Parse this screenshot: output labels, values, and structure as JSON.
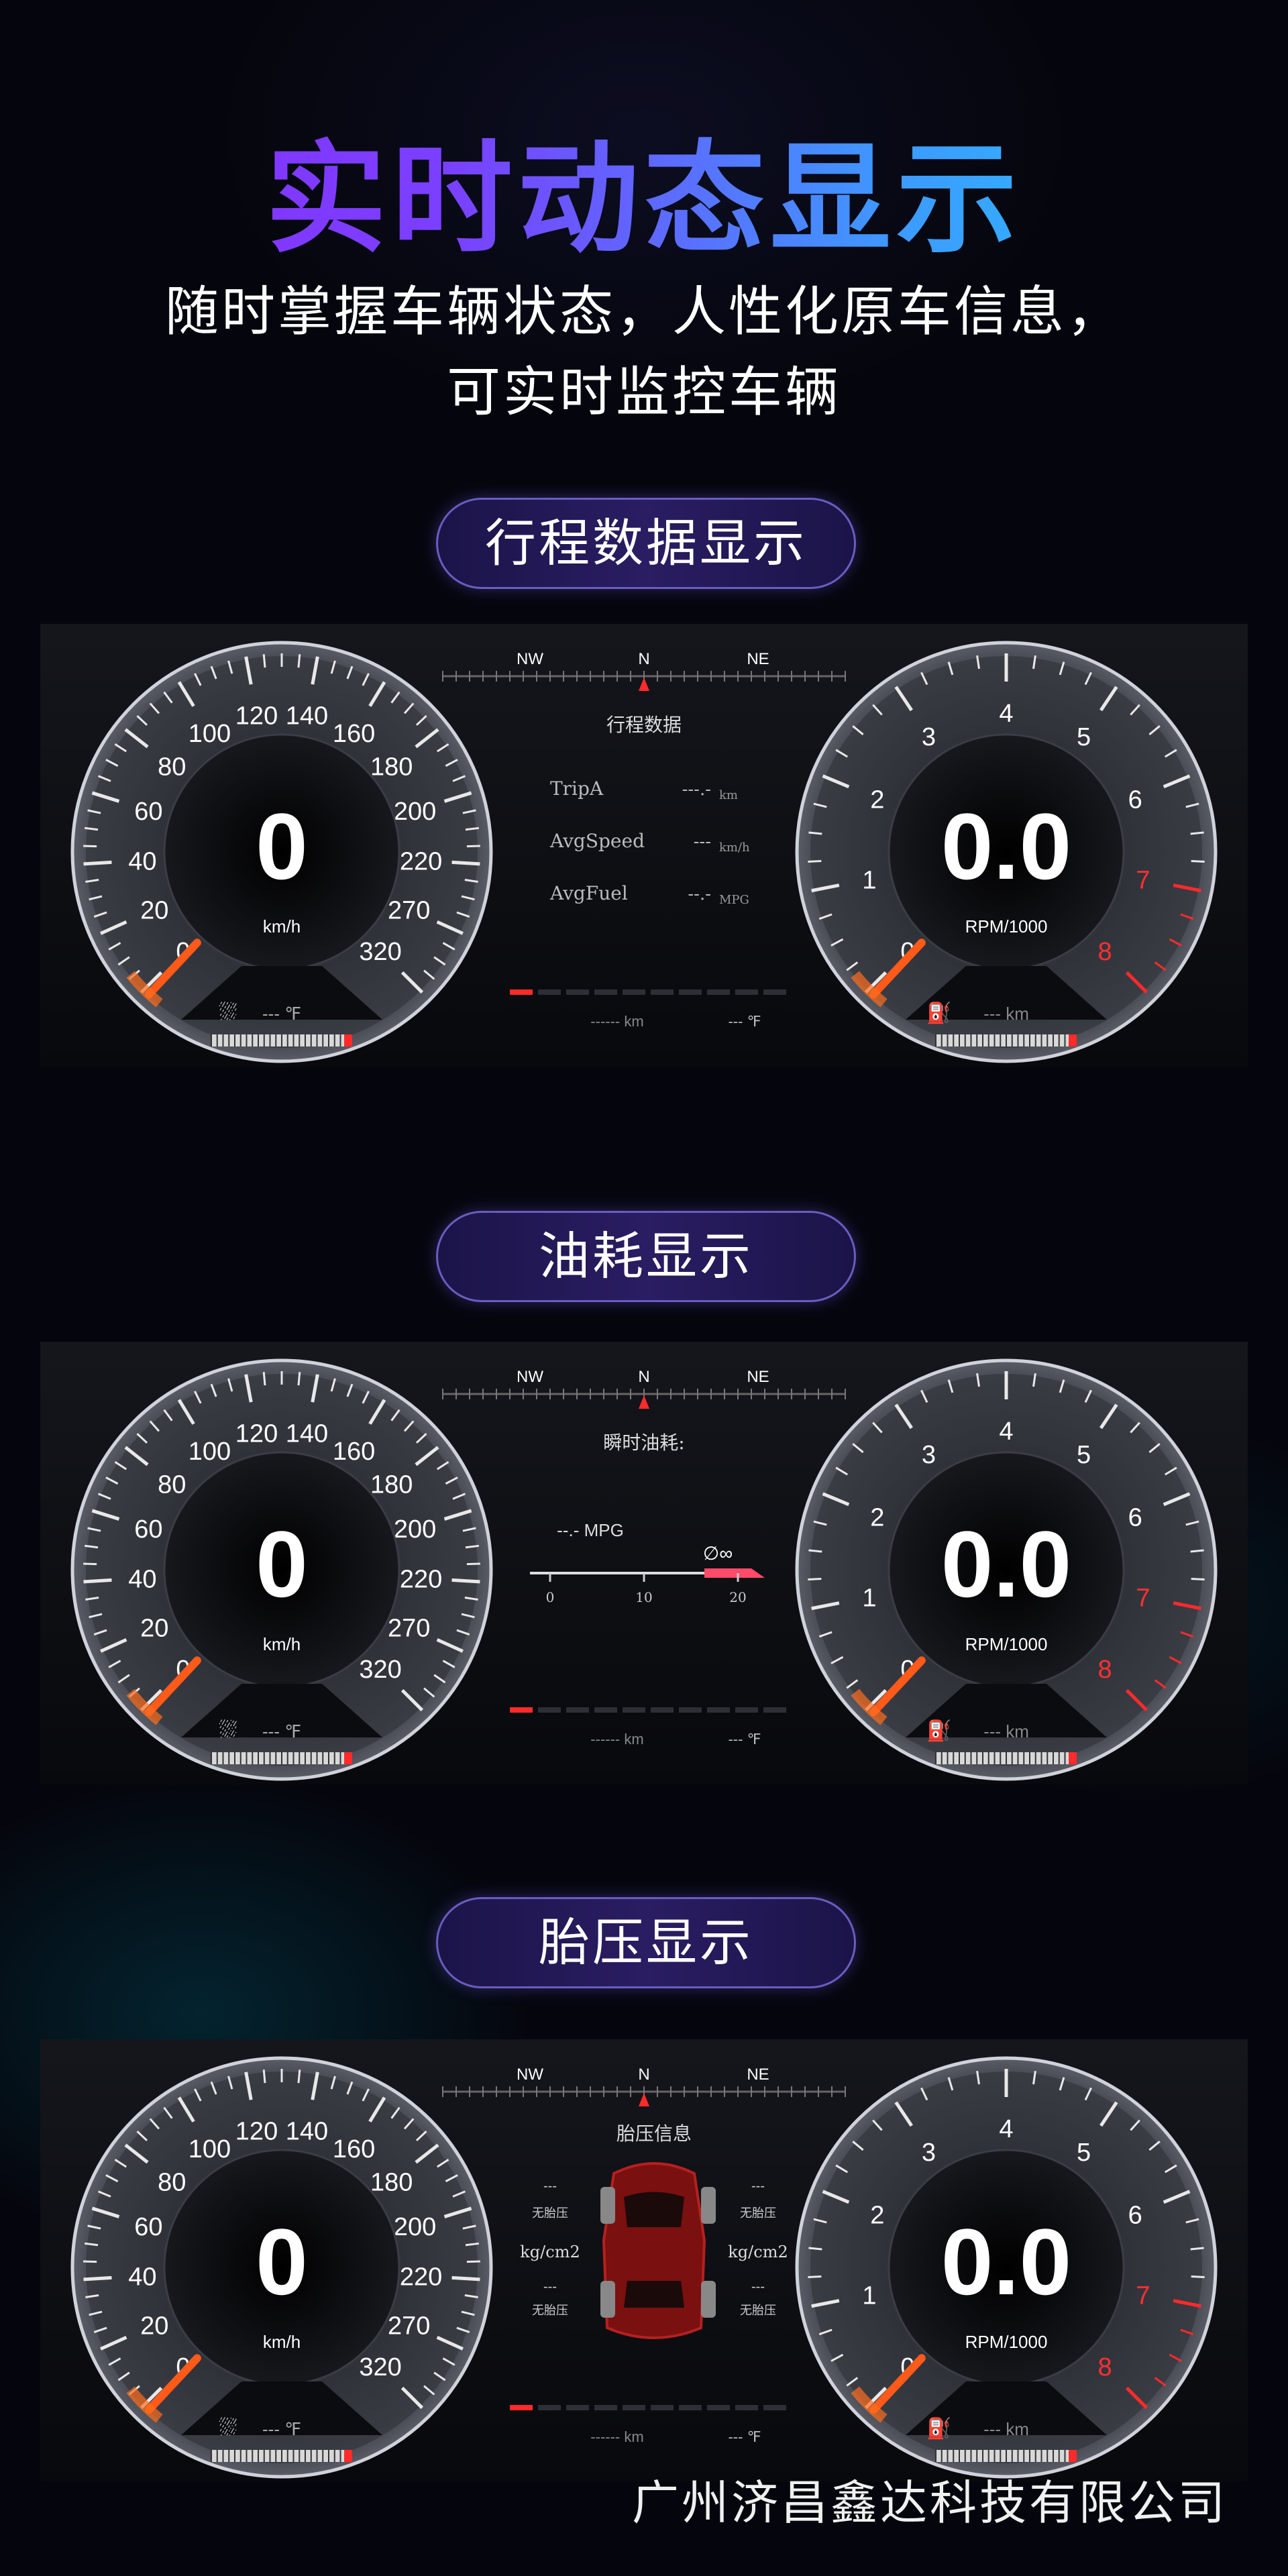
{
  "page": {
    "title": "实时动态显示",
    "subtitle_line1": "随时掌握车辆状态，人性化原车信息，",
    "subtitle_line2": "可实时监控车辆",
    "footer": "广州济昌鑫达科技有限公司"
  },
  "colors": {
    "title_gradient_start": "#8a2cff",
    "title_gradient_end": "#27c9ff",
    "needle": "#ff5a1a",
    "redline": "#ff2a2a"
  },
  "shared": {
    "compass": [
      "NW",
      "N",
      "NE"
    ],
    "speed_ticks": [
      "0",
      "20",
      "40",
      "60",
      "80",
      "100",
      "120",
      "140",
      "160",
      "180",
      "200",
      "220",
      "270",
      "320"
    ],
    "speed_value": "0",
    "speed_unit": "km/h",
    "rpm_ticks": [
      "0",
      "1",
      "2",
      "3",
      "4",
      "5",
      "6",
      "7",
      "8"
    ],
    "rpm_value": "0.0",
    "rpm_unit": "RPM/1000",
    "temp_value": "---",
    "temp_unit": "℉",
    "fuel_value": "---",
    "fuel_unit": "km",
    "odo_value": "------",
    "odo_unit": "km",
    "outside_temp_value": "---",
    "outside_temp_unit": "℉"
  },
  "sections": [
    {
      "pill": "行程数据显示",
      "screen_title": "行程数据",
      "rows": [
        {
          "label": "TripA",
          "value": "---.-",
          "unit": "km"
        },
        {
          "label": "AvgSpeed",
          "value": "---",
          "unit": "km/h"
        },
        {
          "label": "AvgFuel",
          "value": "--.-",
          "unit": "MPG"
        }
      ]
    },
    {
      "pill": "油耗显示",
      "screen_title": "瞬时油耗:",
      "mpg_value": "--.-",
      "mpg_unit": "MPG",
      "infinity": "∅∞",
      "scale": [
        "0",
        "10",
        "20"
      ]
    },
    {
      "pill": "胎压显示",
      "screen_title": "胎压信息",
      "tire_dash": "---",
      "no_sensor": "无胎压",
      "unit": "kg/cm2"
    }
  ]
}
